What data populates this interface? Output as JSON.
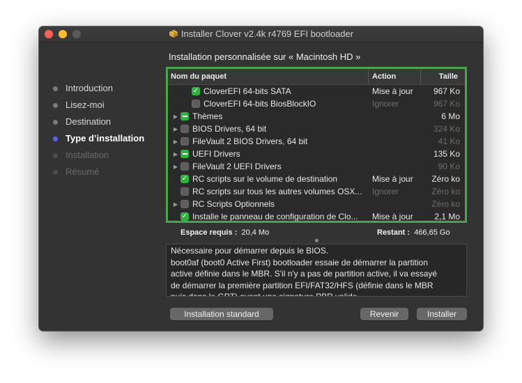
{
  "window": {
    "title": "Installer Clover v2.4k r4769 EFI bootloader"
  },
  "sidebar": {
    "items": [
      {
        "label": "Introduction",
        "state": "done"
      },
      {
        "label": "Lisez-moi",
        "state": "done"
      },
      {
        "label": "Destination",
        "state": "done"
      },
      {
        "label": "Type d’installation",
        "state": "active"
      },
      {
        "label": "Installation",
        "state": "pending"
      },
      {
        "label": "Résumé",
        "state": "pending"
      }
    ]
  },
  "main": {
    "heading": "Installation personnalisée sur « Macintosh HD »",
    "table": {
      "columns": {
        "name": "Nom du paquet",
        "action": "Action",
        "size": "Taille"
      },
      "rows": [
        {
          "name": "CloverEFI 64-bits SATA",
          "action": "Mise à jour",
          "size": "967 Ko",
          "check": "on",
          "expand": false,
          "indent": 2,
          "muted": false
        },
        {
          "name": "CloverEFI 64-bits BiosBlockIO",
          "action": "Ignorer",
          "size": "967 Ko",
          "check": "off",
          "expand": false,
          "indent": 2,
          "muted": true
        },
        {
          "name": "Thèmes",
          "action": "",
          "size": "6 Mo",
          "check": "mixed",
          "expand": true,
          "indent": 0,
          "muted": false
        },
        {
          "name": "BIOS Drivers, 64 bit",
          "action": "",
          "size": "324 Ko",
          "check": "off",
          "expand": true,
          "indent": 0,
          "muted": true
        },
        {
          "name": "FileVault 2 BIOS Drivers, 64 bit",
          "action": "",
          "size": "41 Ko",
          "check": "off",
          "expand": true,
          "indent": 0,
          "muted": true
        },
        {
          "name": "UEFI Drivers",
          "action": "",
          "size": "135 Ko",
          "check": "mixed",
          "expand": true,
          "indent": 0,
          "muted": false
        },
        {
          "name": "FileVault 2 UEFI Drivers",
          "action": "",
          "size": "90 Ko",
          "check": "off",
          "expand": true,
          "indent": 0,
          "muted": true
        },
        {
          "name": "RC scripts sur le volume de destination",
          "action": "Mise à jour",
          "size": "Zéro ko",
          "check": "on",
          "expand": false,
          "indent": 1,
          "muted": false
        },
        {
          "name": "RC scripts sur tous les autres volumes OSX...",
          "action": "Ignorer",
          "size": "Zéro ko",
          "check": "off",
          "expand": false,
          "indent": 1,
          "muted": true
        },
        {
          "name": "RC Scripts Optionnels",
          "action": "",
          "size": "Zéro ko",
          "check": "off",
          "expand": true,
          "indent": 0,
          "muted": true
        },
        {
          "name": "Installe le panneau de configuration de Clo...",
          "action": "Mise à jour",
          "size": "2,1 Mo",
          "check": "on",
          "expand": false,
          "indent": 1,
          "muted": false
        }
      ]
    },
    "space_required_label": "Espace requis :",
    "space_required_value": "20,4 Mo",
    "remaining_label": "Restant :",
    "remaining_value": "466,65 Go",
    "description": [
      "Nécessaire pour démarrer depuis le BIOS.",
      "boot0af (boot0 Active First) bootloader essaie de démarrer la partition",
      "active définie dans le MBR. S'il n'y a pas de partition active, il va essayé",
      "de démarrer la première partition EFI/FAT32/HFS (définie dans le MBR",
      "puis dans le GPT) ayant une signature PBR valide."
    ]
  },
  "buttons": {
    "standard": "Installation standard",
    "back": "Revenir",
    "install": "Installer"
  },
  "colors": {
    "accent": "#4aa44e",
    "checkbox_on": "#2db340",
    "active_step": "#5e63f0",
    "close": "#fe5f57",
    "minimize": "#febc2e"
  },
  "icons": {
    "app": "package-icon",
    "expand": "disclosure-triangle-icon"
  }
}
